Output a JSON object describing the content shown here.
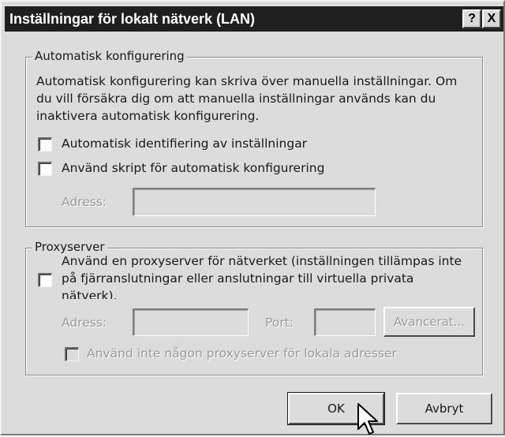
{
  "dialog": {
    "title": "Inställningar för lokalt nätverk (LAN)",
    "help_button": "?",
    "close_button": "X"
  },
  "auto_config": {
    "legend": "Automatisk konfigurering",
    "description_lines": [
      "Automatisk konfigurering kan skriva över manuella inställningar. Om",
      "du vill försäkra dig om att manuella inställningar används kan du",
      "inaktivera automatisk konfigurering."
    ],
    "detect_settings_label": "Automatisk identifiering av inställningar",
    "detect_settings_checked": false,
    "use_script_label": "Använd skript för automatisk konfigurering",
    "use_script_checked": false,
    "address_label": "Adress:",
    "address_value": ""
  },
  "proxy": {
    "legend": "Proxyserver",
    "use_proxy_lines": [
      "Använd en proxyserver för nätverket (inställningen tillämpas inte",
      "på fjärranslutningar eller anslutningar till virtuella privata",
      "nätverk)."
    ],
    "use_proxy_checked": false,
    "address_label": "Adress:",
    "address_value": "",
    "port_label": "Port:",
    "port_value": "",
    "advanced_button": "Avancerat...",
    "bypass_local_label": "Använd inte någon proxyserver för lokala adresser",
    "bypass_local_checked": false
  },
  "buttons": {
    "ok": "OK",
    "cancel": "Avbryt"
  },
  "icons": {
    "cursor": "mouse-pointer-icon"
  }
}
